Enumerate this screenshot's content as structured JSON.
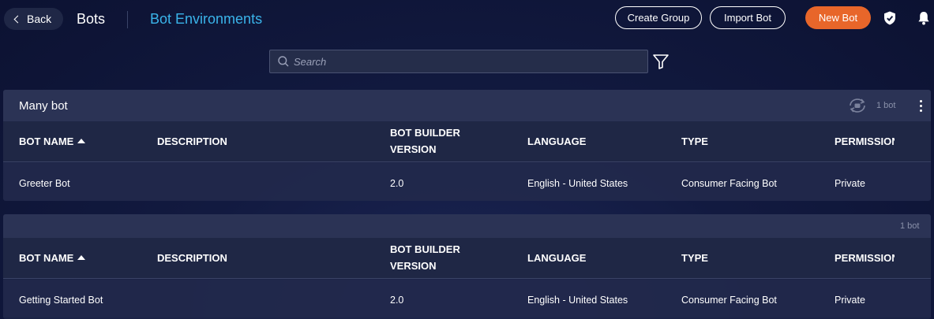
{
  "header": {
    "back_label": "Back",
    "title": "Bots",
    "tab_label": "Bot Environments",
    "create_group_label": "Create Group",
    "import_bot_label": "Import Bot",
    "new_bot_label": "New Bot",
    "accent_color": "#3ab4ea",
    "new_bot_color": "#e8662a"
  },
  "search": {
    "placeholder": "Search"
  },
  "icons": [
    "back-chevron-icon",
    "shield-icon",
    "bell-icon",
    "search-icon",
    "filter-icon",
    "sync-icon",
    "kebab-menu-icon",
    "sort-up-icon"
  ],
  "columns": {
    "bot_name": "BOT NAME",
    "description": "DESCRIPTION",
    "version_line1": "BOT BUILDER",
    "version_line2": "VERSION",
    "language": "LANGUAGE",
    "type": "TYPE",
    "permission": "PERMISSION"
  },
  "groups": [
    {
      "name": "Many bot",
      "count": "1 bot",
      "bots": [
        {
          "name": "Greeter Bot",
          "description": "",
          "version": "2.0",
          "language": "English - United States",
          "type": "Consumer Facing Bot",
          "permission": "Private"
        }
      ]
    },
    {
      "name": "",
      "count": "1 bot",
      "bots": [
        {
          "name": "Getting Started Bot",
          "description": "",
          "version": "2.0",
          "language": "English - United States",
          "type": "Consumer Facing Bot",
          "permission": "Private"
        }
      ]
    }
  ]
}
